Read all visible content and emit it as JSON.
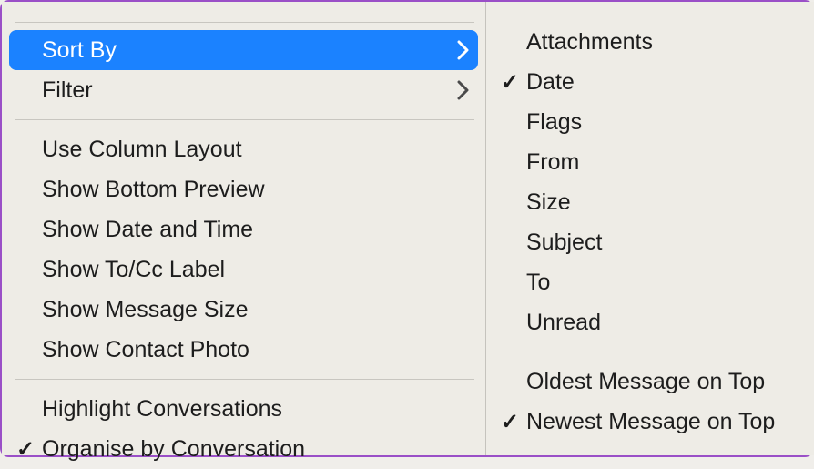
{
  "leftMenu": {
    "group1": [
      {
        "label": "Sort By",
        "hasSubmenu": true,
        "highlighted": true,
        "checked": false
      },
      {
        "label": "Filter",
        "hasSubmenu": true,
        "highlighted": false,
        "checked": false
      }
    ],
    "group2": [
      {
        "label": "Use Column Layout",
        "hasSubmenu": false,
        "highlighted": false,
        "checked": false
      },
      {
        "label": "Show Bottom Preview",
        "hasSubmenu": false,
        "highlighted": false,
        "checked": false
      },
      {
        "label": "Show Date and Time",
        "hasSubmenu": false,
        "highlighted": false,
        "checked": false
      },
      {
        "label": "Show To/Cc Label",
        "hasSubmenu": false,
        "highlighted": false,
        "checked": false
      },
      {
        "label": "Show Message Size",
        "hasSubmenu": false,
        "highlighted": false,
        "checked": false
      },
      {
        "label": "Show Contact Photo",
        "hasSubmenu": false,
        "highlighted": false,
        "checked": false
      }
    ],
    "group3": [
      {
        "label": "Highlight Conversations",
        "hasSubmenu": false,
        "highlighted": false,
        "checked": false
      },
      {
        "label": "Organise by Conversation",
        "hasSubmenu": false,
        "highlighted": false,
        "checked": true
      }
    ]
  },
  "rightMenu": {
    "group1": [
      {
        "label": "Attachments",
        "checked": false
      },
      {
        "label": "Date",
        "checked": true
      },
      {
        "label": "Flags",
        "checked": false
      },
      {
        "label": "From",
        "checked": false
      },
      {
        "label": "Size",
        "checked": false
      },
      {
        "label": "Subject",
        "checked": false
      },
      {
        "label": "To",
        "checked": false
      },
      {
        "label": "Unread",
        "checked": false
      }
    ],
    "group2": [
      {
        "label": "Oldest Message on Top",
        "checked": false
      },
      {
        "label": "Newest Message on Top",
        "checked": true
      }
    ]
  },
  "glyphs": {
    "check": "✓"
  }
}
